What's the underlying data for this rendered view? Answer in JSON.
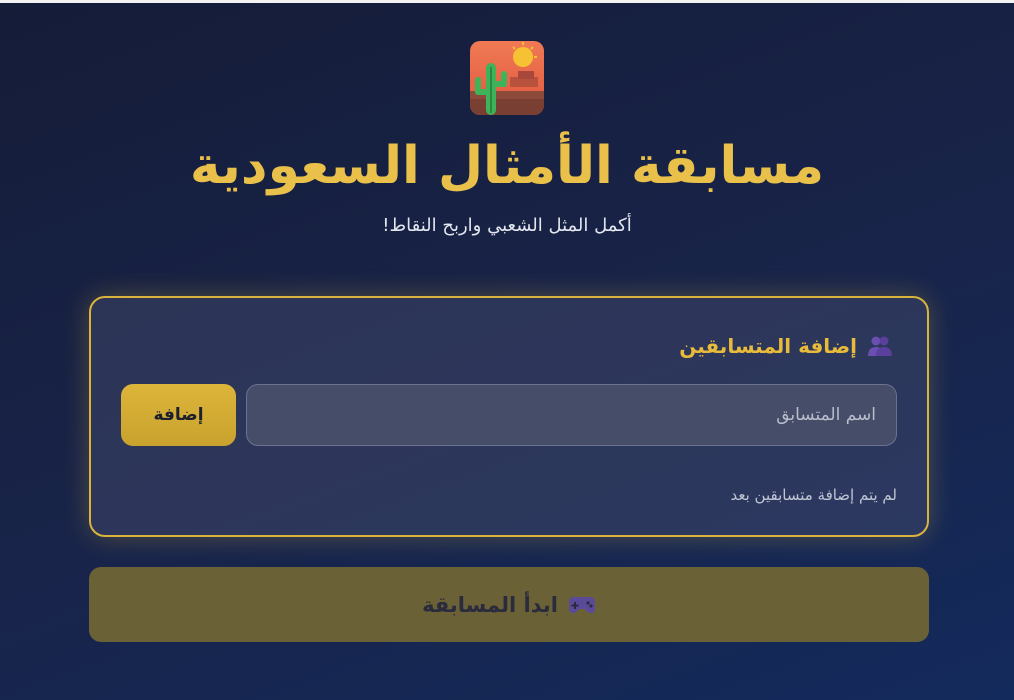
{
  "header": {
    "logo_icon": "desert-cactus-icon",
    "title": "مسابقة الأمثال السعودية",
    "subtitle": "أكمل المثل الشعبي واربح النقاط!"
  },
  "contestants_card": {
    "heading_icon": "users-icon",
    "heading": "إضافة المتسابقين",
    "input_placeholder": "اسم المتسابق",
    "input_value": "",
    "add_label": "إضافة",
    "empty_message": "لم يتم إضافة متسابقين بعد"
  },
  "start": {
    "icon": "gamepad-icon",
    "label": "ابدأ المسابقة"
  },
  "colors": {
    "accent_gold": "#e8c04a",
    "card_border": "#d9b33c",
    "start_button_bg": "#6b6137",
    "background": "#18244a"
  }
}
